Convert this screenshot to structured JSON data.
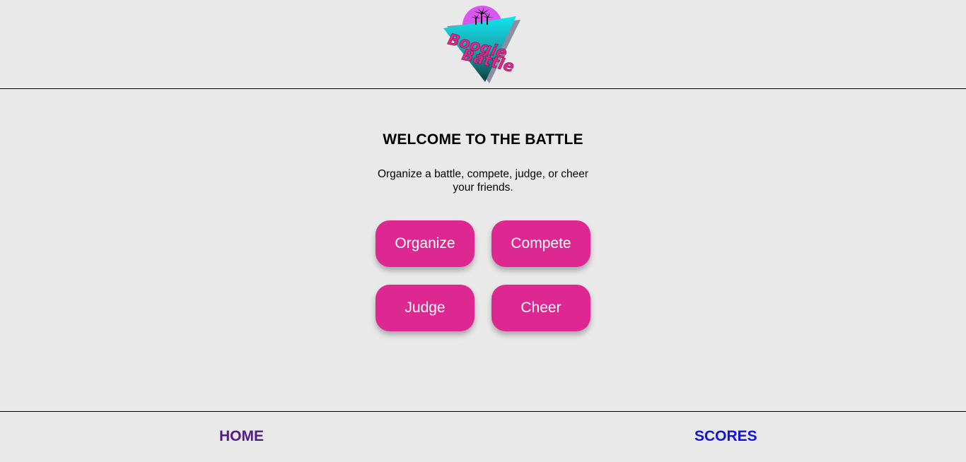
{
  "header": {
    "logo": {
      "text_line1": "Boogie",
      "text_line2": "Battle",
      "colors": {
        "circle": "#d957ee",
        "triangle_top": "#10e5ef",
        "triangle_bottom": "#0d3a3c",
        "text": "#e2278c",
        "palms": "#111111"
      }
    }
  },
  "main": {
    "title": "WELCOME TO THE BATTLE",
    "subtitle": "Organize a battle, compete, judge, or cheer your friends.",
    "buttons": {
      "organize": "Organize",
      "compete": "Compete",
      "judge": "Judge",
      "cheer": "Cheer"
    },
    "button_color": "#de2891"
  },
  "footer": {
    "home": {
      "label": "HOME",
      "color": "#581a8b"
    },
    "scores": {
      "label": "SCORES",
      "color": "#1212d8"
    }
  }
}
